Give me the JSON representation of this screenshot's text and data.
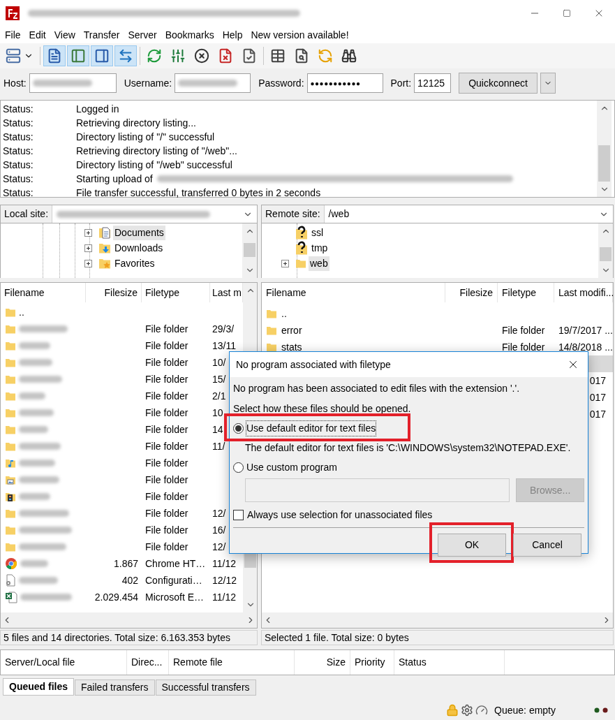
{
  "menu": [
    "File",
    "Edit",
    "View",
    "Transfer",
    "Server",
    "Bookmarks",
    "Help",
    "New version available!"
  ],
  "toolbar": [
    {
      "pressed": false
    },
    {
      "pressed": true
    },
    {
      "pressed": true
    },
    {
      "pressed": true
    },
    {
      "pressed": true
    },
    {
      "pressed": false
    },
    {
      "pressed": false
    },
    {
      "pressed": false
    },
    {
      "pressed": false
    },
    {
      "pressed": false
    },
    {
      "pressed": false
    },
    {
      "pressed": false
    },
    {
      "pressed": false
    },
    {
      "pressed": false
    }
  ],
  "quickconnect": {
    "fields": [
      {
        "label": "Host:",
        "blurred": true
      },
      {
        "label": "Username:",
        "blurred": true
      },
      {
        "label": "Password:",
        "value": "●●●●●●●●●●●"
      },
      {
        "label": "Port:",
        "value": "12125"
      }
    ],
    "button": "Quickconnect"
  },
  "log": [
    {
      "label": "Status:",
      "message": "Logged in"
    },
    {
      "label": "Status:",
      "message": "Retrieving directory listing..."
    },
    {
      "label": "Status:",
      "message": "Directory listing of \"/\" successful"
    },
    {
      "label": "Status:",
      "message": "Retrieving directory listing of \"/web\"..."
    },
    {
      "label": "Status:",
      "message": "Directory listing of \"/web\" successful"
    },
    {
      "label": "Status:",
      "message": "Starting upload of",
      "blurred": true
    },
    {
      "label": "Status:",
      "message": "File transfer successful, transferred 0 bytes in 2 seconds"
    }
  ],
  "local": {
    "label": "Local site:",
    "path_blurred": true,
    "tree": [
      {
        "label": "Documents",
        "kind": "documents",
        "selected": true,
        "expandable": true
      },
      {
        "label": "Downloads",
        "kind": "downloads",
        "selected": false,
        "expandable": true
      },
      {
        "label": "Favorites",
        "kind": "favorites",
        "selected": false,
        "expandable": true
      }
    ],
    "columns": [
      "Filename",
      "Filesize",
      "Filetype",
      "Last m"
    ],
    "rows": [
      {
        "kind": "folder",
        "name": "..",
        "blurred": false
      },
      {
        "kind": "folder",
        "blurred": true,
        "type": "File folder",
        "date": "29/3/"
      },
      {
        "kind": "folder",
        "blurred": true,
        "type": "File folder",
        "date": "13/11"
      },
      {
        "kind": "folder",
        "blurred": true,
        "type": "File folder",
        "date": "10/"
      },
      {
        "kind": "folder",
        "blurred": true,
        "type": "File folder",
        "date": "15/"
      },
      {
        "kind": "folder",
        "blurred": true,
        "type": "File folder",
        "date": "2/1"
      },
      {
        "kind": "folder",
        "blurred": true,
        "type": "File folder",
        "date": "10"
      },
      {
        "kind": "folder",
        "blurred": true,
        "type": "File folder",
        "date": "14"
      },
      {
        "kind": "folder",
        "blurred": true,
        "type": "File folder",
        "date": "11/"
      },
      {
        "kind": "music",
        "blurred": true,
        "type": "File folder"
      },
      {
        "kind": "pictures",
        "blurred": true,
        "type": "File folder"
      },
      {
        "kind": "videos",
        "blurred": true,
        "type": "File folder"
      },
      {
        "kind": "folder",
        "blurred": true,
        "type": "File folder",
        "date": "12/"
      },
      {
        "kind": "folder",
        "blurred": true,
        "type": "File folder",
        "date": "16/"
      },
      {
        "kind": "folder",
        "blurred": true,
        "type": "File folder",
        "date": "12/"
      },
      {
        "kind": "chrome",
        "blurred": true,
        "size": "1.867",
        "type": "Chrome HT…",
        "date": "11/12"
      },
      {
        "kind": "config",
        "blurred": true,
        "size": "402",
        "type": "Configurati…",
        "date": "12/12"
      },
      {
        "kind": "excel",
        "blurred": true,
        "size": "2.029.454",
        "type": "Microsoft E…",
        "date": "11/12"
      }
    ],
    "status": "5 files and 14 directories. Total size: 6.163.353 bytes"
  },
  "remote": {
    "label": "Remote site:",
    "path": "/web",
    "tree": [
      {
        "label": "ssl",
        "kind": "unknown",
        "selected": false,
        "expandable": false
      },
      {
        "label": "tmp",
        "kind": "unknown",
        "selected": false,
        "expandable": false
      },
      {
        "label": "web",
        "kind": "folder",
        "selected": true,
        "expandable": true
      }
    ],
    "columns": [
      "Filename",
      "Filesize",
      "Filetype",
      "Last modifi..."
    ],
    "rows": [
      {
        "name": "..",
        "selected": false
      },
      {
        "name": "error",
        "type": "File folder",
        "date": "19/7/2017 ...",
        "selected": false
      },
      {
        "name": "stats",
        "type": "File folder",
        "date": "14/8/2018 ...",
        "selected": false
      },
      {
        "selected": true
      },
      {
        "date": "017",
        "cut_left": true,
        "selected": false
      },
      {
        "date": "017",
        "cut_left": true,
        "selected": false
      },
      {
        "date": "017",
        "cut_left": true,
        "selected": false
      }
    ],
    "status": "Selected 1 file. Total size: 0 bytes"
  },
  "dialog": {
    "title": "No program associated with filetype",
    "message": "No program has been associated to edit files with the extension '.'.",
    "prompt": "Select how these files should be opened.",
    "options": [
      {
        "label": "Use default editor for text files",
        "selected": true,
        "highlighted": true,
        "note": "The default editor for text files is 'C:\\WINDOWS\\system32\\NOTEPAD.EXE'."
      },
      {
        "label": "Use custom program",
        "selected": false,
        "highlighted": false
      }
    ],
    "program_field": {
      "disabled": true
    },
    "browse_button": {
      "label": "Browse...",
      "disabled": true
    },
    "checkbox": {
      "label": "Always use selection for unassociated files",
      "checked": false
    },
    "buttons": [
      {
        "label": "OK",
        "highlighted": true
      },
      {
        "label": "Cancel",
        "highlighted": false
      }
    ]
  },
  "queue": {
    "columns": [
      "Server/Local file",
      "Direc...",
      "Remote file",
      "Size",
      "Priority",
      "Status"
    ],
    "tabs": [
      {
        "label": "Queued files",
        "selected": true
      },
      {
        "label": "Failed transfers",
        "selected": false
      },
      {
        "label": "Successful transfers",
        "selected": false
      }
    ]
  },
  "status_bar": {
    "queue": "Queue: empty"
  }
}
